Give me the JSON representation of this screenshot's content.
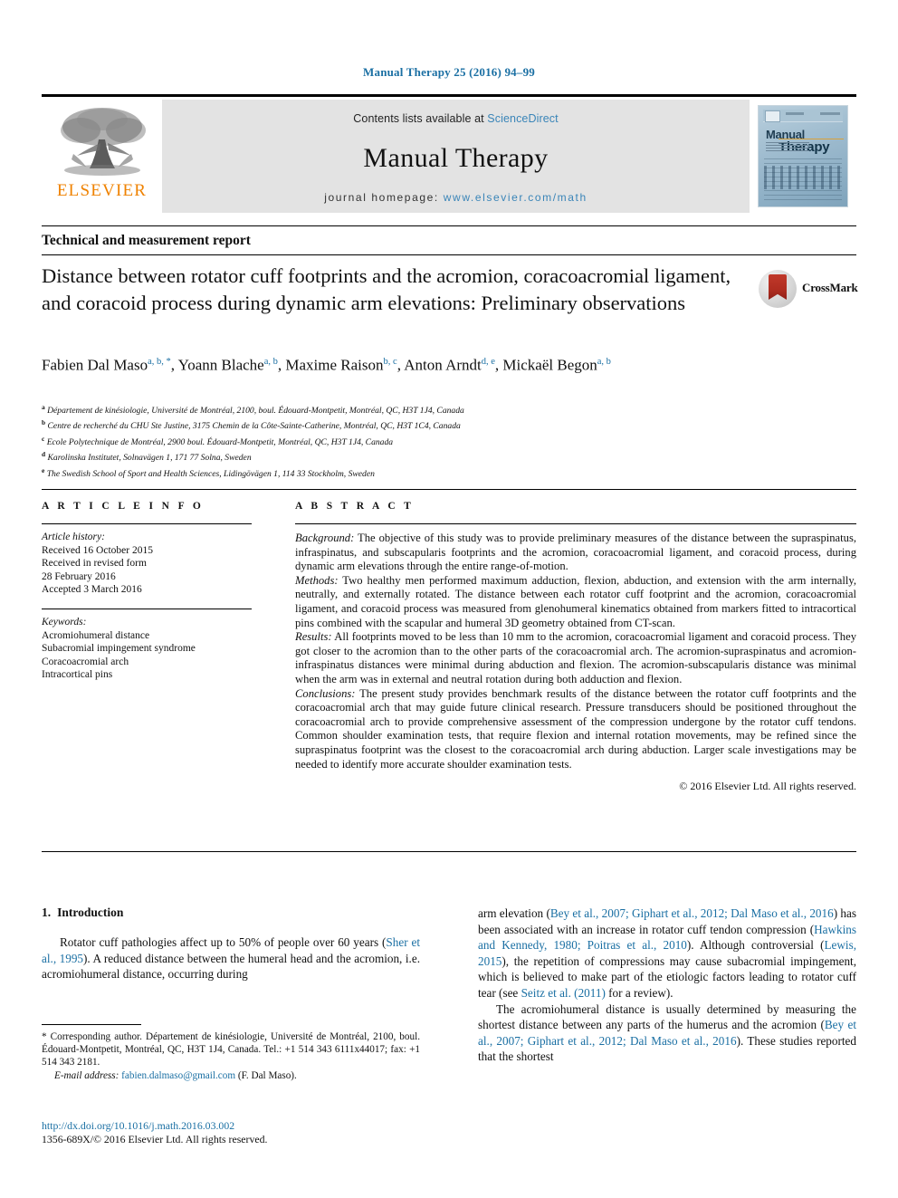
{
  "running_head": "Manual Therapy 25 (2016) 94–99",
  "masthead": {
    "publisher_logo_text": "ELSEVIER",
    "contents_prefix": "Contents lists available at ",
    "contents_link": "ScienceDirect",
    "journal_name": "Manual Therapy",
    "homepage_prefix": "journal homepage: ",
    "homepage_url": "www.elsevier.com/math",
    "cover": {
      "line1": "Manual",
      "line2": "Therapy"
    }
  },
  "article": {
    "kicker": "Technical and measurement report",
    "title": "Distance between rotator cuff footprints and the acromion, coracoacromial ligament, and coracoid process during dynamic arm elevations: Preliminary observations",
    "crossmark_label": "CrossMark",
    "authors_line1": "Fabien Dal Maso",
    "authors": [
      {
        "name": "Fabien Dal Maso",
        "marks": "a, b, *"
      },
      {
        "name": "Yoann Blache",
        "marks": "a, b"
      },
      {
        "name": "Maxime Raison",
        "marks": "b, c"
      },
      {
        "name": "Anton Arndt",
        "marks": "d, e"
      },
      {
        "name": "Mickaël Begon",
        "marks": "a, b"
      }
    ],
    "affiliations": [
      {
        "mark": "a",
        "text": "Département de kinésiologie, Université de Montréal, 2100, boul. Édouard-Montpetit, Montréal, QC, H3T 1J4, Canada"
      },
      {
        "mark": "b",
        "text": "Centre de recherché du CHU Ste Justine, 3175 Chemin de la Côte-Sainte-Catherine, Montréal, QC, H3T 1C4, Canada"
      },
      {
        "mark": "c",
        "text": "Ecole Polytechnique de Montréal, 2900 boul. Édouard-Montpetit, Montréal, QC, H3T 1J4, Canada"
      },
      {
        "mark": "d",
        "text": "Karolinska Institutet, Solnavägen 1, 171 77 Solna, Sweden"
      },
      {
        "mark": "e",
        "text": "The Swedish School of Sport and Health Sciences, Lidingövägen 1, 114 33 Stockholm, Sweden"
      }
    ]
  },
  "article_info": {
    "heading": "A R T I C L E   I N F O",
    "history_label": "Article history:",
    "history": [
      "Received 16 October 2015",
      "Received in revised form",
      "28 February 2016",
      "Accepted 3 March 2016"
    ],
    "keywords_label": "Keywords:",
    "keywords": [
      "Acromiohumeral distance",
      "Subacromial impingement syndrome",
      "Coracoacromial arch",
      "Intracortical pins"
    ]
  },
  "abstract": {
    "heading": "A B S T R A C T",
    "sections": [
      {
        "label": "Background:",
        "text": " The objective of this study was to provide preliminary measures of the distance between the supraspinatus, infraspinatus, and subscapularis footprints and the acromion, coracoacromial ligament, and coracoid process, during dynamic arm elevations through the entire range-of-motion."
      },
      {
        "label": "Methods:",
        "text": " Two healthy men performed maximum adduction, flexion, abduction, and extension with the arm internally, neutrally, and externally rotated. The distance between each rotator cuff footprint and the acromion, coracoacromial ligament, and coracoid process was measured from glenohumeral kinematics obtained from markers fitted to intracortical pins combined with the scapular and humeral 3D geometry obtained from CT-scan."
      },
      {
        "label": "Results:",
        "text": " All footprints moved to be less than 10 mm to the acromion, coracoacromial ligament and coracoid process. They got closer to the acromion than to the other parts of the coracoacromial arch. The acromion-supraspinatus and acromion-infraspinatus distances were minimal during abduction and flexion. The acromion-subscapularis distance was minimal when the arm was in external and neutral rotation during both adduction and flexion."
      },
      {
        "label": "Conclusions:",
        "text": " The present study provides benchmark results of the distance between the rotator cuff footprints and the coracoacromial arch that may guide future clinical research. Pressure transducers should be positioned throughout the coracoacromial arch to provide comprehensive assessment of the compression undergone by the rotator cuff tendons. Common shoulder examination tests, that require flexion and internal rotation movements, may be refined since the supraspinatus footprint was the closest to the coracoacromial arch during abduction. Larger scale investigations may be needed to identify more accurate shoulder examination tests."
      }
    ],
    "copyright": "© 2016 Elsevier Ltd. All rights reserved."
  },
  "introduction": {
    "number": "1.",
    "heading": "Introduction",
    "left_p1_a": "Rotator cuff pathologies affect up to 50% of people over 60 years (",
    "left_p1_ref1": "Sher et al., 1995",
    "left_p1_b": "). A reduced distance between the humeral head and the acromion, i.e. acromiohumeral distance, occurring during",
    "right_p1_a": "arm elevation (",
    "right_p1_ref1": "Bey et al., 2007; Giphart et al., 2012; Dal Maso et al., 2016",
    "right_p1_b": ") has been associated with an increase in rotator cuff tendon compression (",
    "right_p1_ref2": "Hawkins and Kennedy, 1980; Poitras et al., 2010",
    "right_p1_c": "). Although controversial (",
    "right_p1_ref3": "Lewis, 2015",
    "right_p1_d": "), the repetition of compressions may cause subacromial impingement, which is believed to make part of the etiologic factors leading to rotator cuff tear (see ",
    "right_p1_ref4": "Seitz et al. (2011)",
    "right_p1_e": " for a review).",
    "right_p2_a": "The acromiohumeral distance is usually determined by measuring the shortest distance between any parts of the humerus and the acromion (",
    "right_p2_ref1": "Bey et al., 2007; Giphart et al., 2012; Dal Maso et al., 2016",
    "right_p2_b": "). These studies reported that the shortest"
  },
  "footnotes": {
    "corresponding": "* Corresponding author. Département de kinésiologie, Université de Montréal, 2100, boul. Édouard-Montpetit, Montréal, QC, H3T 1J4, Canada. Tel.: +1 514 343 6111x44017; fax: +1 514 343 2181.",
    "email_label": "E-mail address:",
    "email": "fabien.dalmaso@gmail.com",
    "email_owner": "(F. Dal Maso).",
    "doi": "http://dx.doi.org/10.1016/j.math.2016.03.002",
    "issn": "1356-689X/© 2016 Elsevier Ltd. All rights reserved."
  },
  "colors": {
    "link": "#1a6fa3",
    "sciencedirect": "#3a85b8",
    "elsevier_orange": "#ef8200",
    "crossmark_red": "#c0392b"
  }
}
